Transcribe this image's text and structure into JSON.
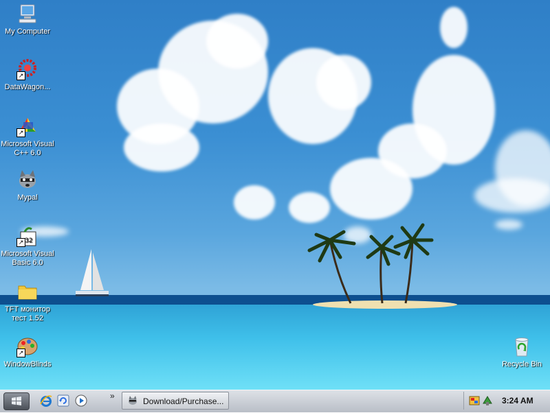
{
  "desktop": {
    "icons": [
      {
        "label": "My Computer",
        "icon": "my-computer-icon"
      },
      {
        "label": "DataWagon...",
        "icon": "datawagon-icon"
      },
      {
        "label": "Microsoft Visual C++ 6.0",
        "icon": "visual-cpp-icon"
      },
      {
        "label": "Mypal",
        "icon": "mypal-raccoon-icon"
      },
      {
        "label": "Microsoft Visual Basic 6.0",
        "icon": "visual-basic-icon"
      },
      {
        "label": "TFT монитор тест 1.52",
        "icon": "folder-icon"
      },
      {
        "label": "WindowBlinds",
        "icon": "windowblinds-icon"
      }
    ],
    "recycle_bin": {
      "label": "Recycle Bin",
      "icon": "recycle-bin-icon"
    },
    "shortcut_arrow": "↗"
  },
  "taskbar": {
    "start_icon": "start-windows-icon",
    "quick_launch": [
      "ie-icon",
      "refresh-icon",
      "media-player-icon"
    ],
    "quick_launch_more": "»",
    "task": {
      "label": "Download/Purchase...",
      "icon": "mypal-raccoon-icon"
    },
    "tray_icons": [
      "network-tray-icon",
      "security-tray-icon"
    ],
    "clock": "3:24 AM"
  }
}
